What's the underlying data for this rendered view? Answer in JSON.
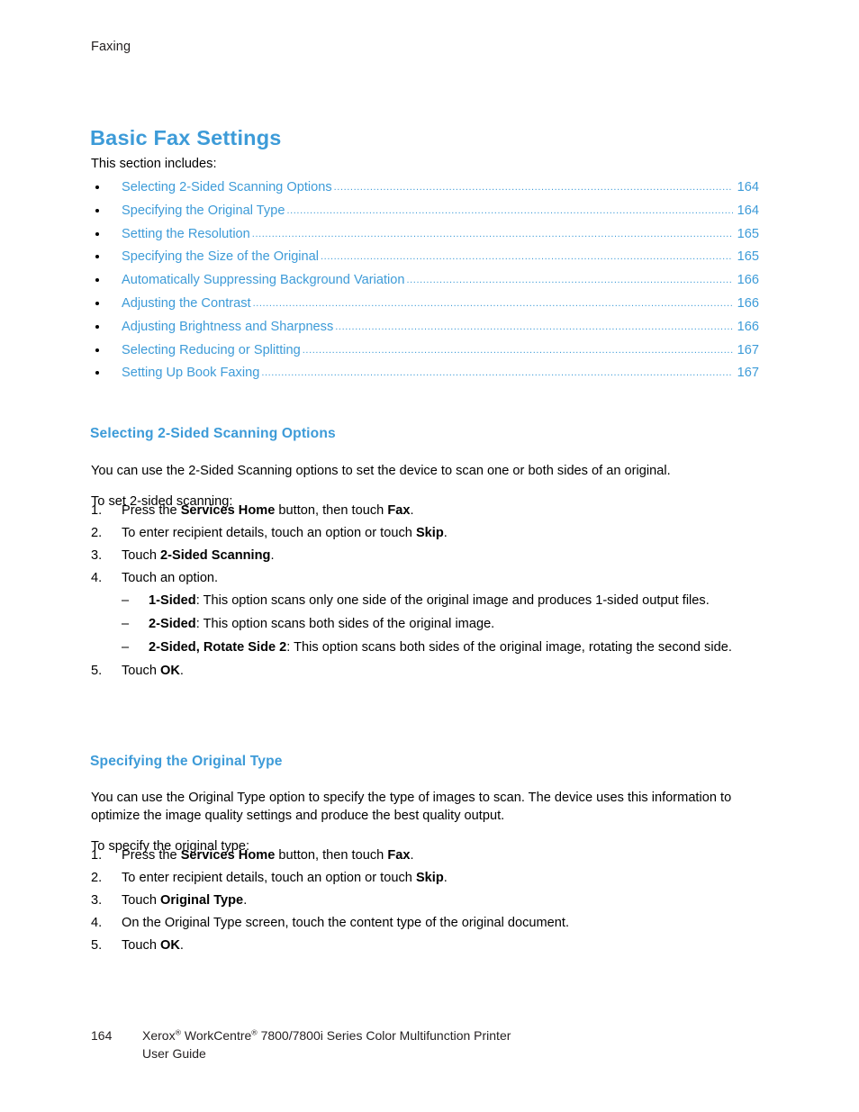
{
  "header": {
    "running_head": "Faxing"
  },
  "page_title": "Basic Fax Settings",
  "intro": "This section includes:",
  "toc": {
    "items": [
      {
        "label": "Selecting 2-Sided Scanning Options",
        "page": "164"
      },
      {
        "label": "Specifying the Original Type",
        "page": "164"
      },
      {
        "label": "Setting the Resolution",
        "page": "165"
      },
      {
        "label": "Specifying the Size of the Original",
        "page": "165"
      },
      {
        "label": "Automatically Suppressing Background Variation",
        "page": "166"
      },
      {
        "label": "Adjusting the Contrast",
        "page": "166"
      },
      {
        "label": "Adjusting Brightness and Sharpness",
        "page": "166"
      },
      {
        "label": "Selecting Reducing or Splitting",
        "page": "167"
      },
      {
        "label": "Setting Up Book Faxing",
        "page": "167"
      }
    ],
    "leader": "................................................................................................................................................................"
  },
  "section1": {
    "heading": "Selecting 2-Sided Scanning Options",
    "para1": "You can use the 2-Sided Scanning options to set the device to scan one or both sides of an original.",
    "para2": "To set 2-sided scanning:",
    "steps": [
      {
        "num": "1.",
        "html": "Press the <b>Services Home</b> button, then touch <b>Fax</b>."
      },
      {
        "num": "2.",
        "html": "To enter recipient details, touch an option or touch <b>Skip</b>."
      },
      {
        "num": "3.",
        "html": "Touch <b>2-Sided Scanning</b>."
      },
      {
        "num": "4.",
        "html": "Touch an option."
      },
      {
        "num": "5.",
        "html": "Touch <b>OK</b>."
      }
    ],
    "suboptions": [
      {
        "dash": "–",
        "html": "<b>1-Sided</b>: This option scans only one side of the original image and produces 1-sided output files."
      },
      {
        "dash": "–",
        "html": "<b>2-Sided</b>: This option scans both sides of the original image."
      },
      {
        "dash": "–",
        "html": "<b>2-Sided, Rotate Side 2</b>: This option scans both sides of the original image, rotating the second side."
      }
    ]
  },
  "section2": {
    "heading": "Specifying the Original Type",
    "para1": "You can use the Original Type option to specify the type of images to scan. The device uses this information to optimize the image quality settings and produce the best quality output.",
    "para2": "To specify the original type:",
    "steps": [
      {
        "num": "1.",
        "html": "Press the <b>Services Home</b> button, then touch <b>Fax</b>."
      },
      {
        "num": "2.",
        "html": "To enter recipient details, touch an option or touch <b>Skip</b>."
      },
      {
        "num": "3.",
        "html": "Touch <b>Original Type</b>."
      },
      {
        "num": "4.",
        "html": "On the Original Type screen, touch the content type of the original document."
      },
      {
        "num": "5.",
        "html": "Touch <b>OK</b>."
      }
    ]
  },
  "footer": {
    "page_number": "164",
    "line1_html": "Xerox<sup>®</sup> WorkCentre<sup>®</sup> 7800/7800i Series Color Multifunction Printer",
    "line2": "User Guide"
  },
  "colors": {
    "heading_blue": "#3d9bd8",
    "link_blue": "#3d9bd8",
    "body_black": "#000000",
    "footer_gray": "#231f20"
  }
}
